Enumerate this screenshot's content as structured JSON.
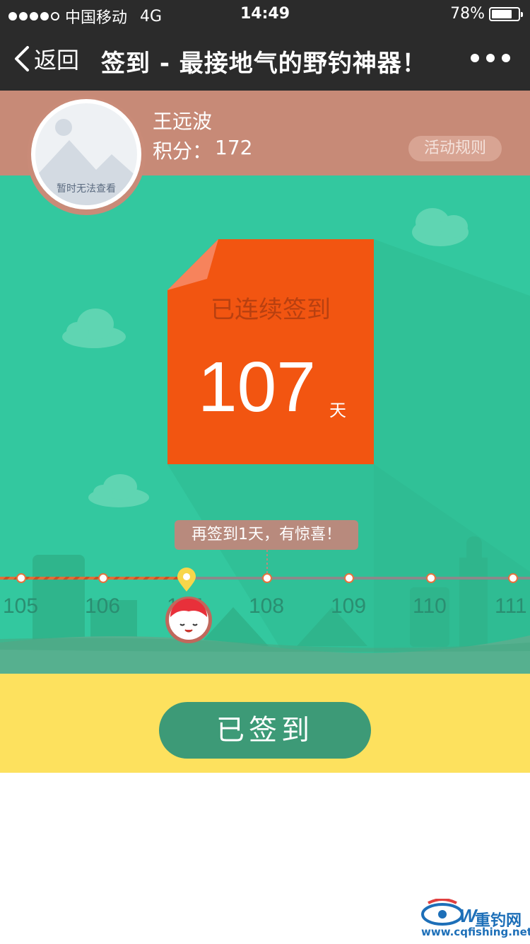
{
  "status_bar": {
    "carrier": "中国移动",
    "network": "4G",
    "time": "14:49",
    "battery_percent": "78%",
    "battery_level": 0.78
  },
  "nav": {
    "back_label": "返回",
    "title": "签到 - 最接地气的野钓神器！"
  },
  "profile": {
    "avatar_placeholder": "暂时无法查看",
    "username": "王远波",
    "points_label": "积分：",
    "points_value": "172",
    "rules_button": "活动规则"
  },
  "checkin": {
    "label": "已连续签到",
    "days": "107",
    "unit": "天"
  },
  "timeline": {
    "tooltip": "再签到1天，有惊喜！",
    "days": [
      "105",
      "106",
      "107",
      "108",
      "109",
      "110",
      "111"
    ],
    "current_index": 2
  },
  "action": {
    "signed_button": "已签到"
  },
  "watermark": {
    "brand": "重钓网",
    "url": "www.cqfishing.net"
  },
  "colors": {
    "main_bg": "#33c89f",
    "card": "#f25511",
    "profile_bg": "#c78a77",
    "footer_bg": "#fde15e",
    "button": "#3d9a77"
  }
}
